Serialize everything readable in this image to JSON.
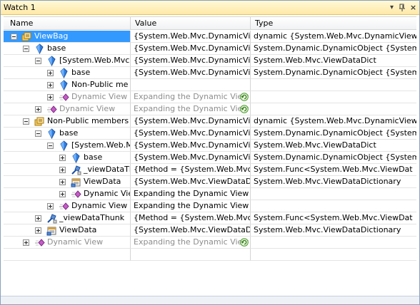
{
  "window": {
    "title": "Watch 1",
    "dropdown_glyph": "▾",
    "pin_glyph": "⊣",
    "close_glyph": "×"
  },
  "columns": {
    "name": "Name",
    "value": "Value",
    "type": "Type"
  },
  "rows": [
    {
      "name": "ViewBag",
      "value": "{System.Web.Mvc.DynamicView",
      "type": "dynamic {System.Web.Mvc.DynamicView",
      "icon": "object-icon",
      "expander": "minus",
      "gray": false
    },
    {
      "name": "base",
      "value": "{System.Web.Mvc.DynamicView",
      "type": "System.Dynamic.DynamicObject {System",
      "icon": "field-icon",
      "expander": "minus",
      "gray": false
    },
    {
      "name": "[System.Web.Mvc.",
      "value": "{System.Web.Mvc.DynamicView",
      "type": "System.Web.Mvc.ViewDataDict",
      "icon": "field-icon",
      "expander": "minus",
      "gray": false
    },
    {
      "name": "base",
      "value": "{System.Web.Mvc.DynamicView",
      "type": "System.Dynamic.DynamicObject {System",
      "icon": "field-icon",
      "expander": "plus",
      "gray": false
    },
    {
      "name": "Non-Public me",
      "value": "",
      "type": "",
      "icon": "field-icon",
      "expander": "plus",
      "gray": false
    },
    {
      "name": "Dynamic View",
      "value": "Expanding the Dynamic View",
      "type": "",
      "icon": "dynamic-view-icon",
      "expander": "plus",
      "gray": true,
      "refresh": true
    },
    {
      "name": "Dynamic View",
      "value": "Expanding the Dynamic View",
      "type": "",
      "icon": "dynamic-view-icon",
      "expander": "plus",
      "gray": true,
      "refresh": true
    },
    {
      "name": "Non-Public members",
      "value": "{System.Web.Mvc.DynamicView",
      "type": "dynamic {System.Web.Mvc.DynamicView",
      "icon": "object-icon",
      "expander": "minus",
      "gray": false
    },
    {
      "name": "base",
      "value": "{System.Web.Mvc.DynamicView",
      "type": "System.Dynamic.DynamicObject {System",
      "icon": "field-icon",
      "expander": "minus",
      "gray": false
    },
    {
      "name": "[System.Web.M",
      "value": "{System.Web.Mvc.DynamicView",
      "type": "System.Web.Mvc.ViewDataDict",
      "icon": "field-icon",
      "expander": "minus",
      "gray": false
    },
    {
      "name": "base",
      "value": "{System.Web.Mvc.DynamicView",
      "type": "System.Dynamic.DynamicObject {System",
      "icon": "field-icon",
      "expander": "plus",
      "gray": false
    },
    {
      "name": "_viewDataTh",
      "value": "{Method = {System.Web.Mvc.V",
      "type": "System.Func<System.Web.Mvc.ViewDat",
      "icon": "delegate-icon",
      "expander": "plus",
      "gray": false
    },
    {
      "name": "ViewData",
      "value": "{System.Web.Mvc.ViewDataDic",
      "type": "System.Web.Mvc.ViewDataDictionary",
      "icon": "property-icon",
      "expander": "plus",
      "gray": false
    },
    {
      "name": "Dynamic Viev",
      "value": "Expanding the Dynamic View w",
      "type": "",
      "icon": "dynamic-view-icon",
      "expander": "plus",
      "gray": false
    },
    {
      "name": "Dynamic View",
      "value": "Expanding the Dynamic View w",
      "type": "",
      "icon": "dynamic-view-icon",
      "expander": "plus",
      "gray": false
    },
    {
      "name": "_viewDataThunk",
      "value": "{Method = {System.Web.Mvc.V",
      "type": "System.Func<System.Web.Mvc.ViewDat",
      "icon": "delegate-icon",
      "expander": "plus",
      "gray": false
    },
    {
      "name": "ViewData",
      "value": "{System.Web.Mvc.ViewDataDic",
      "type": "System.Web.Mvc.ViewDataDictionary",
      "icon": "property-icon",
      "expander": "plus",
      "gray": false
    },
    {
      "name": "Dynamic View",
      "value": "Expanding the Dynamic View",
      "type": "",
      "icon": "dynamic-view-icon",
      "expander": "plus",
      "gray": true,
      "refresh": true
    }
  ]
}
